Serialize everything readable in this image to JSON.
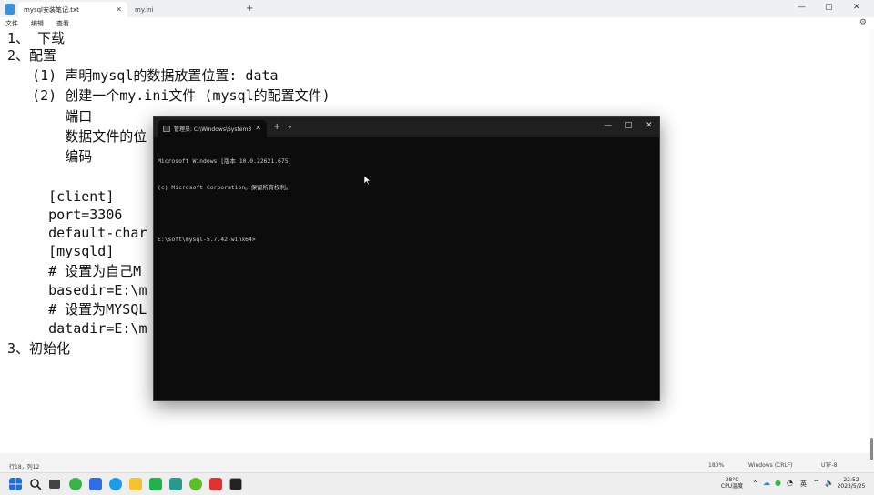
{
  "notepad": {
    "tabs": [
      {
        "label": "mysql安装笔记.txt",
        "active": true
      },
      {
        "label": "my.ini",
        "active": false
      }
    ],
    "new_tab": "+",
    "menu": [
      "文件",
      "编辑",
      "查看"
    ],
    "lines": [
      "1、 下载",
      "2、配置",
      "   (1) 声明mysql的数据放置位置: data",
      "   (2) 创建一个my.ini文件 (mysql的配置文件)",
      "       端口",
      "       数据文件的位",
      "       编码",
      "",
      "    [client]",
      "    port=3306",
      "    default-char",
      "    [mysqld]",
      "    # 设置为自己M",
      "    basedir=E:\\m",
      "    # 设置为MYSQL",
      "    datadir=E:\\m",
      "3、初始化"
    ],
    "status": {
      "position": "行18，列12",
      "zoom": "180%",
      "line_ending": "Windows (CRLF)",
      "encoding": "UTF-8"
    }
  },
  "terminal": {
    "tab_title": "管理员: C:\\Windows\\System3",
    "lines": [
      "Microsoft Windows [版本 10.0.22621.675]",
      "(c) Microsoft Corporation。保留所有权利。",
      "",
      "E:\\soft\\mysql-5.7.42-winx64>"
    ]
  },
  "taskbar": {
    "weather_temp": "38°C",
    "weather_label": "CPU温度",
    "ime": "英",
    "time": "22:52",
    "date": "2023/5/25"
  },
  "colors": {
    "terminal_bg": "#0c0c0c",
    "terminal_text": "#cccccc",
    "notepad_bg": "#ffffff"
  }
}
